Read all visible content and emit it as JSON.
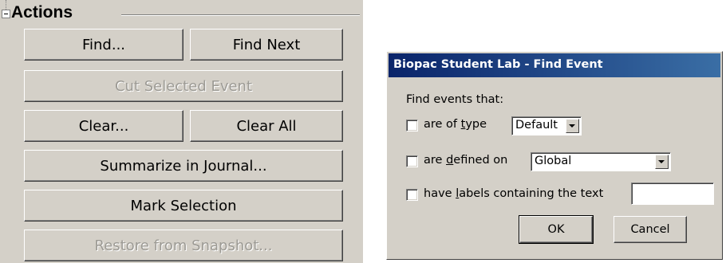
{
  "actions_panel": {
    "title": "Actions",
    "buttons": {
      "find": "Find...",
      "find_next": "Find Next",
      "cut_selected_event": "Cut Selected Event",
      "clear": "Clear...",
      "clear_all": "Clear All",
      "summarize_in_journal": "Summarize in Journal...",
      "mark_selection": "Mark Selection",
      "restore_from_snapshot": "Restore from Snapshot..."
    },
    "disabled": [
      "cut_selected_event",
      "restore_from_snapshot"
    ]
  },
  "find_dialog": {
    "title": "Biopac Student Lab - Find Event",
    "prompt": "Find events that:",
    "criteria": {
      "type": {
        "label_before": "are of ",
        "label_accel": "t",
        "label_after": "ype",
        "checked": false,
        "selected_value": "Default"
      },
      "defined_on": {
        "label_before": "are ",
        "label_accel": "d",
        "label_after": "efined on",
        "checked": false,
        "selected_value": "Global"
      },
      "labels_text": {
        "label_before": "have ",
        "label_accel": "l",
        "label_after": "abels containing the text",
        "checked": false,
        "value": ""
      }
    },
    "buttons": {
      "ok": "OK",
      "cancel": "Cancel"
    }
  },
  "colors": {
    "face": "#d4d0c8",
    "titlebar_start": "#0a246a",
    "titlebar_end": "#3a6ea5",
    "disabled_text": "#9c9a94"
  }
}
